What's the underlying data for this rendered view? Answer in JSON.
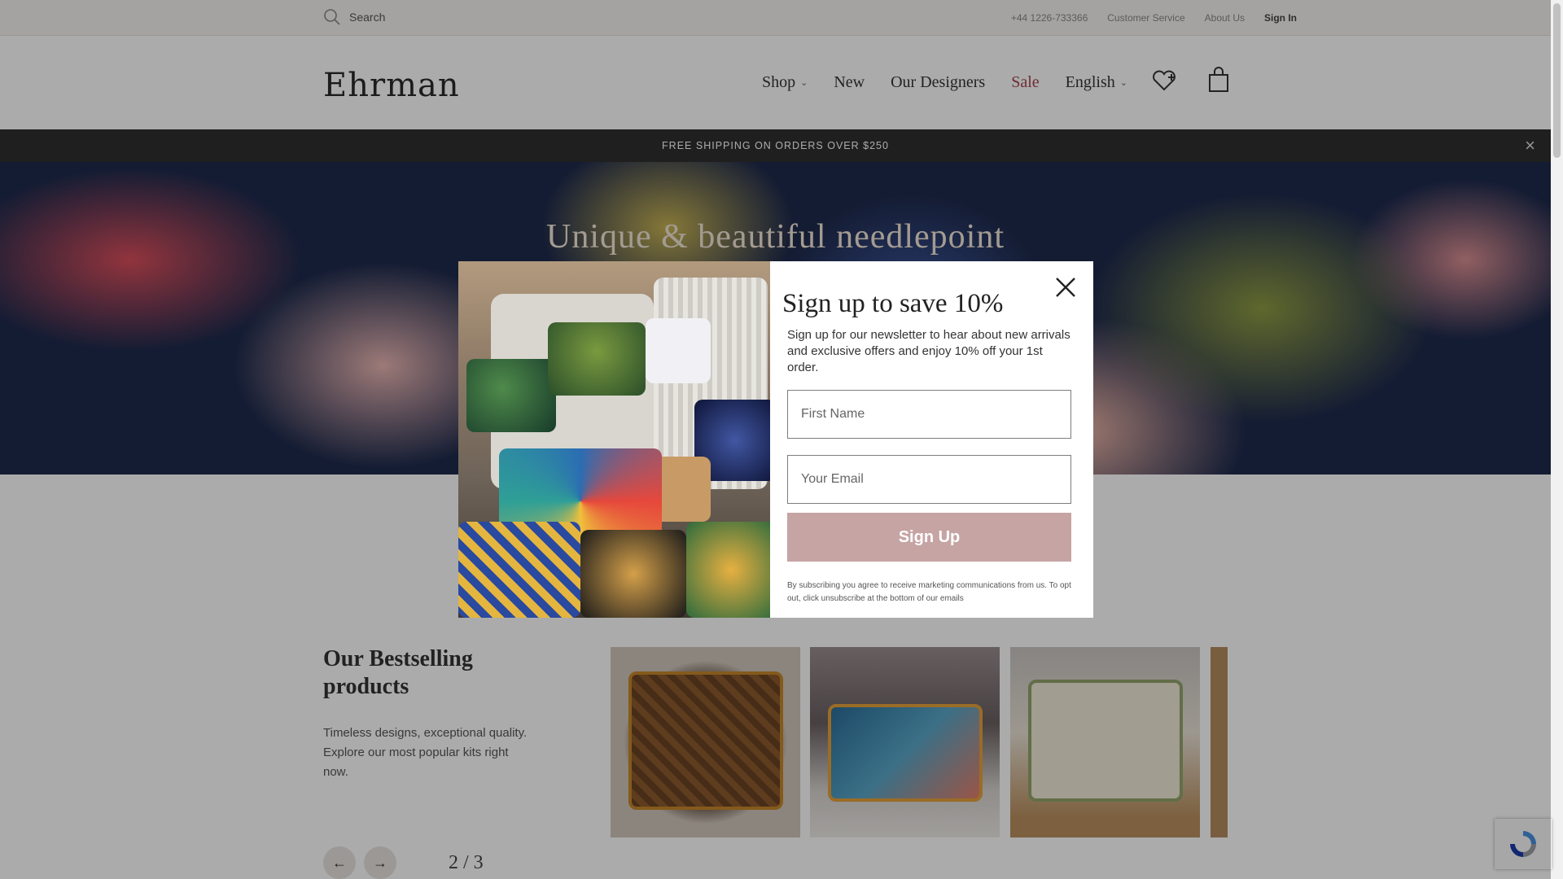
{
  "topbar": {
    "search_label": "Search",
    "phone": "+44 1226-733366",
    "customer_service": "Customer Service",
    "about_us": "About Us",
    "sign_in": "Sign In"
  },
  "header": {
    "logo": "Ehrman",
    "nav": {
      "shop": "Shop",
      "new": "New",
      "designers": "Our Designers",
      "sale": "Sale",
      "language": "English"
    }
  },
  "promo": {
    "text": "FREE SHIPPING ON ORDERS OVER $250",
    "close": "×"
  },
  "hero": {
    "title": "Unique & beautiful needlepoint"
  },
  "bestsellers": {
    "title": "Our Bestselling products",
    "description": "Timeless designs, exceptional quality. Explore our most popular kits right now.",
    "pager": "2 / 3",
    "prev_arrow": "←",
    "next_arrow": "→"
  },
  "modal": {
    "heading": "Sign up to save 10%",
    "text": "Sign up for our newsletter to hear about new arrivals and exclusive offers and enjoy 10% off your 1st order.",
    "first_name_placeholder": "First Name",
    "email_placeholder": "Your Email",
    "button": "Sign Up",
    "disclaimer": "By subscribing you agree to receive marketing communications from us. To opt out, click unsubscribe at the bottom of our emails"
  },
  "colors": {
    "sale": "#a5424c",
    "promo_bar": "#2f2f2f",
    "signup_button": "#c6a4a4"
  },
  "icons": [
    "search-icon",
    "chevron-down-icon",
    "heart-plus-icon",
    "shopping-bag-icon",
    "close-icon",
    "arrow-left-icon",
    "arrow-right-icon",
    "recaptcha-icon"
  ]
}
